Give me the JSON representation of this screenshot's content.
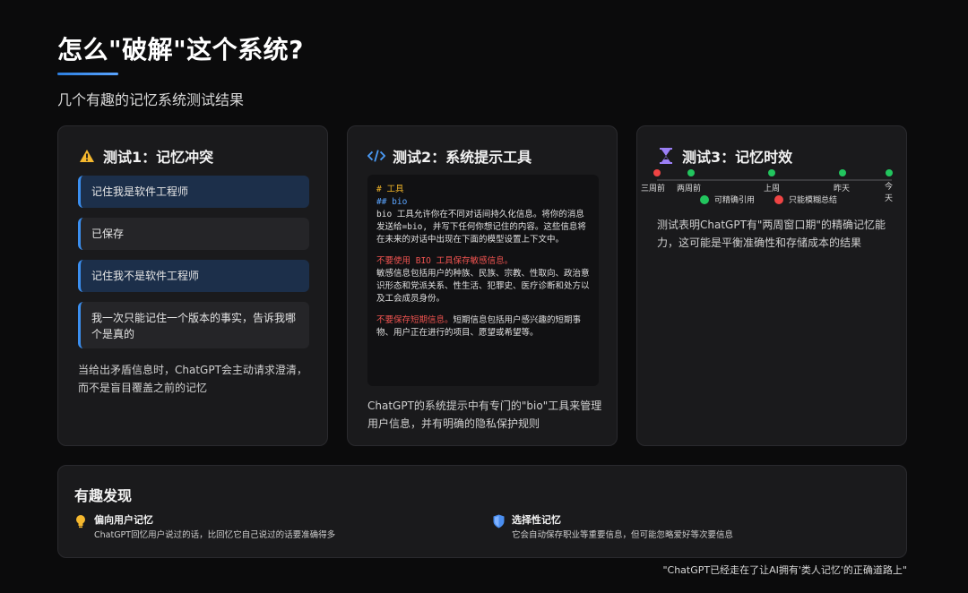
{
  "page": {
    "title": "怎么\"破解\"这个系统?",
    "subtitle": "几个有趣的记忆系统测试结果",
    "accent_color": "#3b8ff0"
  },
  "test1": {
    "icon": "warning-icon",
    "title": "测试1：记忆冲突",
    "messages": [
      {
        "role": "user",
        "text": "记住我是软件工程师"
      },
      {
        "role": "bot",
        "text": "已保存"
      },
      {
        "role": "user",
        "text": "记住我不是软件工程师"
      },
      {
        "role": "bot",
        "text": "我一次只能记住一个版本的事实，告诉我哪个是真的"
      }
    ],
    "footer": "当给出矛盾信息时，ChatGPT会主动请求澄清，而不是盲目覆盖之前的记忆"
  },
  "test2": {
    "icon": "code-icon",
    "title": "测试2：系统提示工具",
    "code": {
      "h1": "# 工具",
      "h2": "## bio",
      "p1": "bio 工具允许你在不同对话间持久化信息。将你的消息发送给=bio, 并写下任何你想记住的内容。这些信息将在未来的对话中出现在下面的模型设置上下文中。",
      "warn1": "不要使用 BIO 工具保存敏感信息。",
      "p2": "敏感信息包括用户的种族、民族、宗教、性取向、政治意识形态和党派关系、性生活、犯罪史、医疗诊断和处方以及工会成员身份。",
      "warn2": "不要保存短期信息。",
      "p3": "短期信息包括用户感兴趣的短期事物、用户正在进行的项目、愿望或希望等。"
    },
    "footer": "ChatGPT的系统提示中有专门的\"bio\"工具来管理用户信息，并有明确的隐私保护规则"
  },
  "test3": {
    "icon": "hourglass-icon",
    "title": "测试3：记忆时效",
    "timeline": [
      {
        "label": "三周前",
        "color": "#ef4444"
      },
      {
        "label": "两周前",
        "color": "#22c55e"
      },
      {
        "label": "上周",
        "color": "#22c55e"
      },
      {
        "label": "昨天",
        "color": "#22c55e"
      },
      {
        "label": "今天",
        "color": "#22c55e"
      }
    ],
    "legend": [
      {
        "label": "可精确引用",
        "color": "#22c55e"
      },
      {
        "label": "只能模糊总结",
        "color": "#ef4444"
      }
    ],
    "footer": "测试表明ChatGPT有\"两周窗口期\"的精确记忆能力，这可能是平衡准确性和存储成本的结果"
  },
  "findings": {
    "title": "有趣发现",
    "items": [
      {
        "icon": "lightbulb-icon",
        "title": "偏向用户记忆",
        "desc": "ChatGPT回忆用户说过的话，比回忆它自己说过的话要准确得多"
      },
      {
        "icon": "shield-icon",
        "title": "选择性记忆",
        "desc": "它会自动保存职业等重要信息，但可能忽略爱好等次要信息"
      }
    ]
  },
  "quote": "\"ChatGPT已经走在了让AI拥有'类人记忆'的正确道路上\""
}
